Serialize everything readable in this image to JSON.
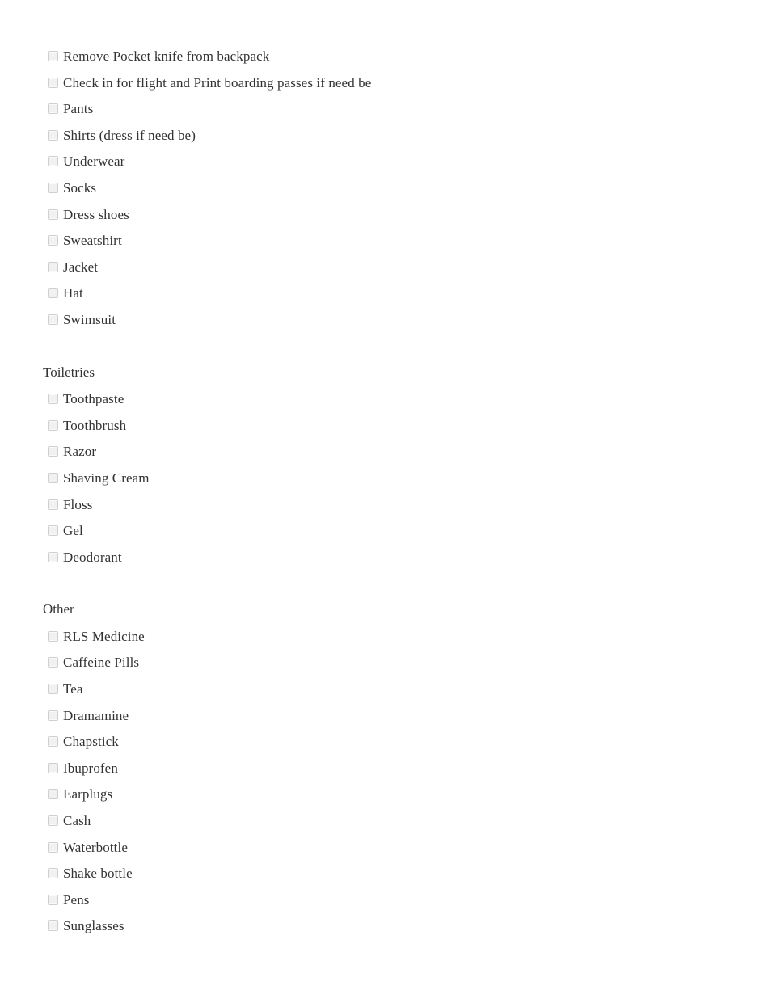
{
  "document": {
    "type": "checklist",
    "background_color": "#ffffff",
    "text_color": "#333333",
    "checkbox_fill_color": "#f1f1f1",
    "checkbox_border_color": "#cfcfcf"
  },
  "groups": [
    {
      "heading": "",
      "has_heading": false,
      "items": [
        {
          "label": "Remove Pocket knife from backpack",
          "checked": false
        },
        {
          "label": "Check in for flight and Print boarding passes if need be",
          "checked": false
        },
        {
          "label": "Pants",
          "checked": false
        },
        {
          "label": "Shirts (dress if need be)",
          "checked": false
        },
        {
          "label": "Underwear",
          "checked": false
        },
        {
          "label": "Socks",
          "checked": false
        },
        {
          "label": "Dress shoes",
          "checked": false
        },
        {
          "label": "Sweatshirt",
          "checked": false
        },
        {
          "label": "Jacket",
          "checked": false
        },
        {
          "label": "Hat",
          "checked": false
        },
        {
          "label": "Swimsuit",
          "checked": false
        }
      ]
    },
    {
      "heading": "Toiletries",
      "has_heading": true,
      "items": [
        {
          "label": "Toothpaste",
          "checked": false
        },
        {
          "label": "Toothbrush",
          "checked": false
        },
        {
          "label": "Razor",
          "checked": false
        },
        {
          "label": "Shaving Cream",
          "checked": false
        },
        {
          "label": "Floss",
          "checked": false
        },
        {
          "label": "Gel",
          "checked": false
        },
        {
          "label": "Deodorant",
          "checked": false
        }
      ]
    },
    {
      "heading": "Other",
      "has_heading": true,
      "items": [
        {
          "label": "RLS Medicine",
          "checked": false
        },
        {
          "label": "Caffeine Pills",
          "checked": false
        },
        {
          "label": "Tea",
          "checked": false
        },
        {
          "label": "Dramamine",
          "checked": false
        },
        {
          "label": "Chapstick",
          "checked": false
        },
        {
          "label": "Ibuprofen",
          "checked": false
        },
        {
          "label": "Earplugs",
          "checked": false
        },
        {
          "label": "Cash",
          "checked": false
        },
        {
          "label": "Waterbottle",
          "checked": false
        },
        {
          "label": "Shake bottle",
          "checked": false
        },
        {
          "label": "Pens",
          "checked": false
        },
        {
          "label": "Sunglasses",
          "checked": false
        }
      ]
    }
  ]
}
